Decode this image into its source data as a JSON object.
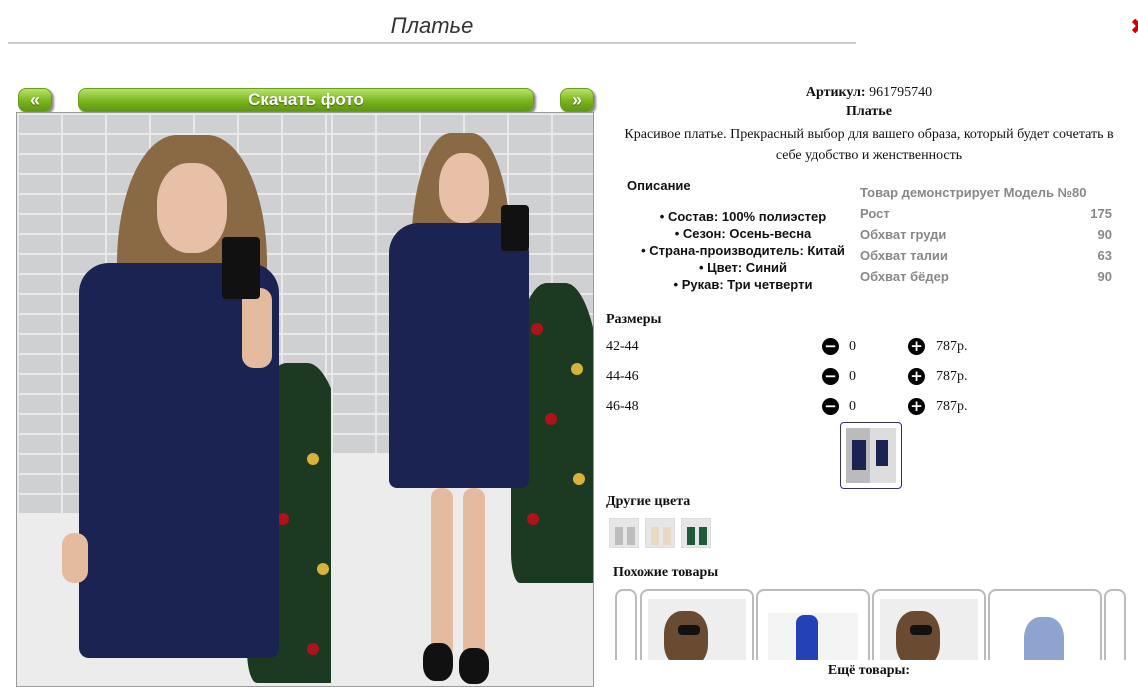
{
  "page": {
    "title": "Платье",
    "close_glyph": "✖"
  },
  "gallery": {
    "prev_label": "«",
    "download_label": "Скачать фото",
    "next_label": "»"
  },
  "product": {
    "article_label": "Артикул:",
    "article_value": "961795740",
    "name": "Платье",
    "description": "Красивое платье. Прекрасный выбор для вашего образа, который будет сочетать в себе удобство и женственность"
  },
  "specs": {
    "title": "Описание",
    "items": [
      "Состав: 100% полиэстер",
      "Сезон: Осень-весна",
      "Страна-производитель: Китай",
      "Цвет: Синий",
      "Рукав: Три четверти"
    ]
  },
  "model": {
    "title": "Товар демонстрирует Модель №80",
    "rows": [
      {
        "label": "Рост",
        "value": "175"
      },
      {
        "label": "Обхват груди",
        "value": "90"
      },
      {
        "label": "Обхват талии",
        "value": "63"
      },
      {
        "label": "Обхват бёдер",
        "value": "90"
      }
    ]
  },
  "sizes": {
    "title": "Размеры",
    "minus_glyph": "−",
    "plus_glyph": "+",
    "rows": [
      {
        "size": "42-44",
        "qty": "0",
        "price": "787р."
      },
      {
        "size": "44-46",
        "qty": "0",
        "price": "787р."
      },
      {
        "size": "46-48",
        "qty": "0",
        "price": "787р."
      }
    ]
  },
  "colors": {
    "title": "Другие цвета"
  },
  "similar": {
    "title": "Похожие товары"
  },
  "more": {
    "title": "Ещё товары:"
  },
  "accent": {
    "button_green": "#79b41c",
    "close_red": "#cc0000",
    "dress_navy": "#1b2352"
  }
}
